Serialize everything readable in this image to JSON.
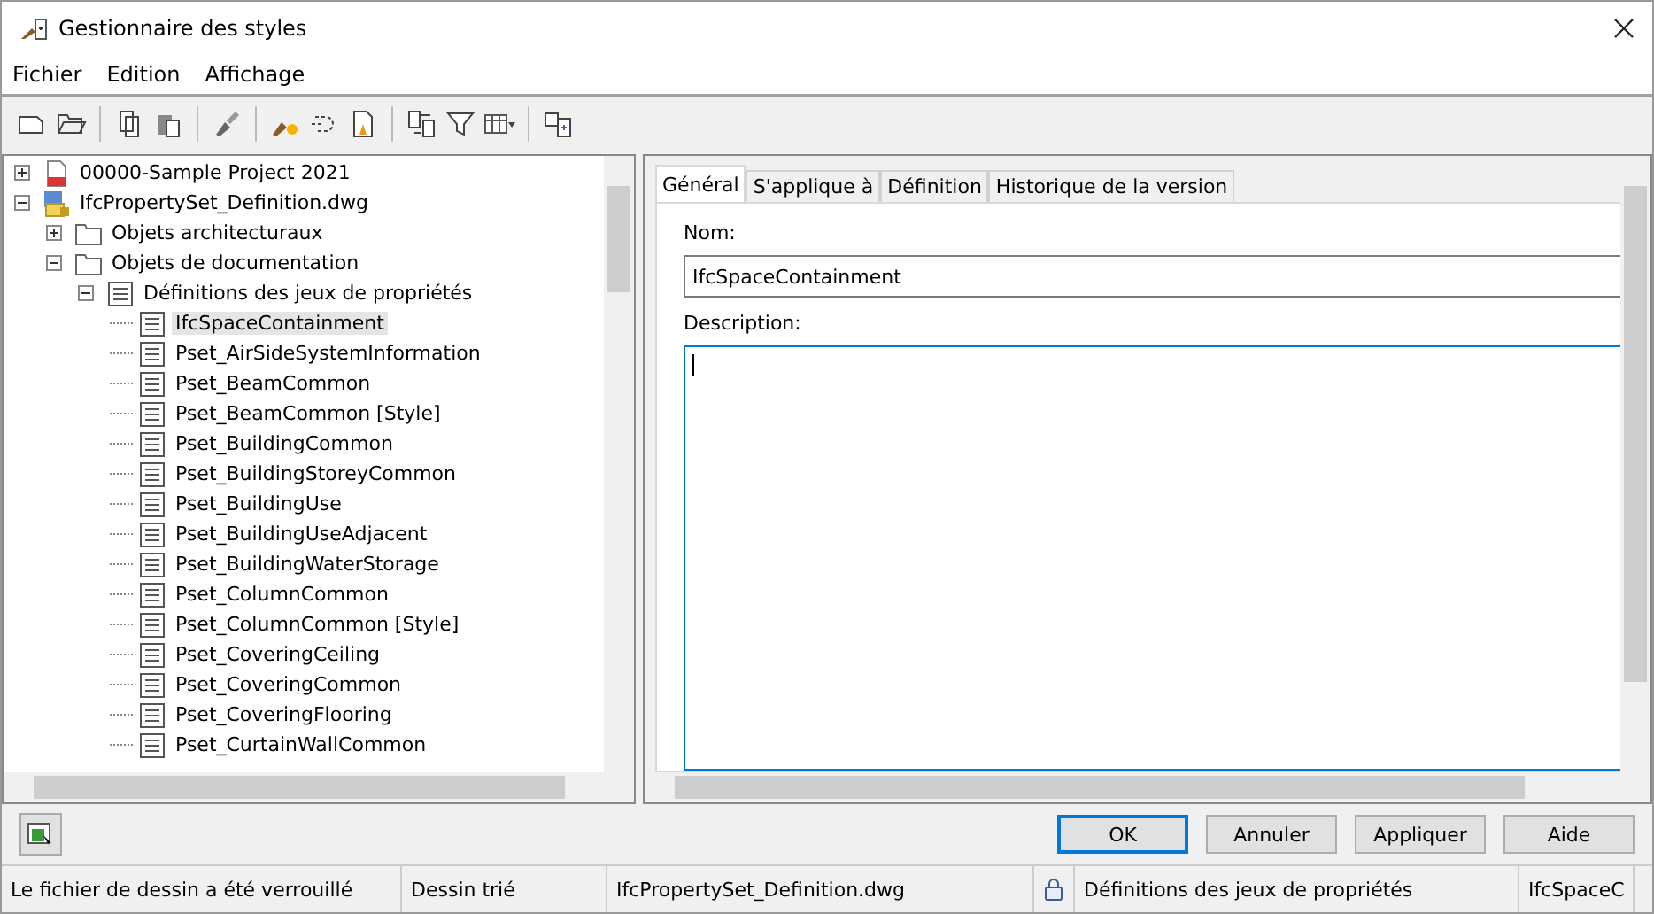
{
  "window": {
    "title": "Gestionnaire des styles"
  },
  "menu": [
    "Fichier",
    "Edition",
    "Affichage"
  ],
  "tree": [
    {
      "label": "00000-Sample Project 2021",
      "kind": "project",
      "expanded": false,
      "selected": false
    },
    {
      "label": "IfcPropertySet_Definition.dwg",
      "kind": "drawing",
      "expanded": true,
      "selected": false,
      "children": [
        {
          "label": "Objets architecturaux",
          "kind": "folder",
          "expanded": false,
          "selected": false
        },
        {
          "label": "Objets de documentation",
          "kind": "folder",
          "expanded": true,
          "selected": false,
          "children": [
            {
              "label": "Définitions des jeux de propriétés",
              "kind": "list",
              "expanded": true,
              "selected": false,
              "children": [
                {
                  "label": "IfcSpaceContainment",
                  "kind": "list",
                  "selected": true
                },
                {
                  "label": "Pset_AirSideSystemInformation",
                  "kind": "list",
                  "selected": false
                },
                {
                  "label": "Pset_BeamCommon",
                  "kind": "list",
                  "selected": false
                },
                {
                  "label": "Pset_BeamCommon [Style]",
                  "kind": "list",
                  "selected": false
                },
                {
                  "label": "Pset_BuildingCommon",
                  "kind": "list",
                  "selected": false
                },
                {
                  "label": "Pset_BuildingStoreyCommon",
                  "kind": "list",
                  "selected": false
                },
                {
                  "label": "Pset_BuildingUse",
                  "kind": "list",
                  "selected": false
                },
                {
                  "label": "Pset_BuildingUseAdjacent",
                  "kind": "list",
                  "selected": false
                },
                {
                  "label": "Pset_BuildingWaterStorage",
                  "kind": "list",
                  "selected": false
                },
                {
                  "label": "Pset_ColumnCommon",
                  "kind": "list",
                  "selected": false
                },
                {
                  "label": "Pset_ColumnCommon [Style]",
                  "kind": "list",
                  "selected": false
                },
                {
                  "label": "Pset_CoveringCeiling",
                  "kind": "list",
                  "selected": false
                },
                {
                  "label": "Pset_CoveringCommon",
                  "kind": "list",
                  "selected": false
                },
                {
                  "label": "Pset_CoveringFlooring",
                  "kind": "list",
                  "selected": false
                },
                {
                  "label": "Pset_CurtainWallCommon",
                  "kind": "list",
                  "selected": false
                }
              ]
            }
          ]
        }
      ]
    }
  ],
  "tabs": [
    {
      "label": "Général",
      "selected": true
    },
    {
      "label": "S'applique à",
      "selected": false
    },
    {
      "label": "Définition",
      "selected": false
    },
    {
      "label": "Historique de la version",
      "selected": false
    }
  ],
  "name_field": {
    "label": "Nom:",
    "value": "IfcSpaceContainment",
    "focused": false
  },
  "description_field": {
    "label": "Description:",
    "focused": true
  },
  "buttons": [
    {
      "label": "OK",
      "default": true
    },
    {
      "label": "Annuler",
      "default": false
    },
    {
      "label": "Appliquer",
      "default": false
    },
    {
      "label": "Aide",
      "default": false
    }
  ],
  "status_bar": [
    {
      "text": "Le fichier de dessin a été verrouillé",
      "kind": "text"
    },
    {
      "text": "Dessin trié",
      "kind": "text"
    },
    {
      "text": "IfcPropertySet_Definition.dwg",
      "kind": "text"
    },
    {
      "kind": "lock"
    },
    {
      "text": "Définitions des jeux de propriétés",
      "kind": "text"
    },
    {
      "text": "IfcSpaceC",
      "kind": "text"
    }
  ]
}
